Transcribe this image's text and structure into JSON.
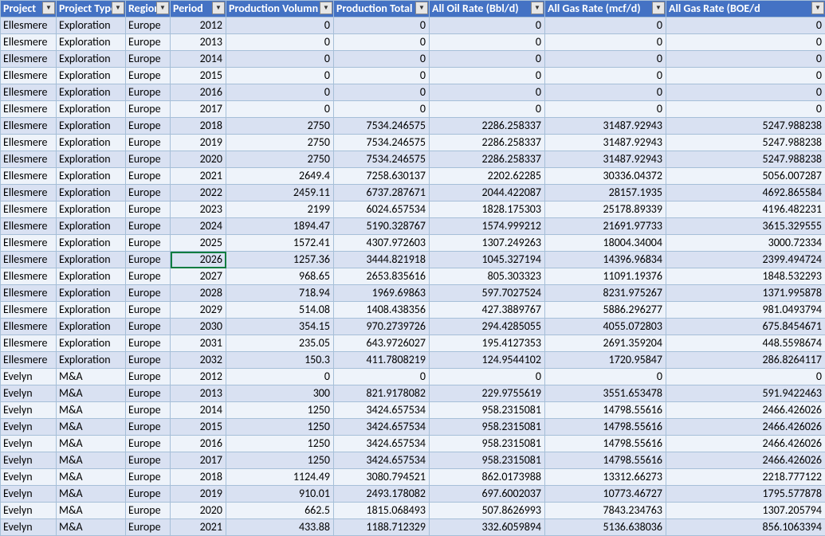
{
  "columns": [
    {
      "label": "Project",
      "align": "txt"
    },
    {
      "label": "Project Type",
      "align": "txt"
    },
    {
      "label": "Region",
      "align": "txt"
    },
    {
      "label": "Period",
      "align": "num"
    },
    {
      "label": "Production Volumn",
      "align": "num"
    },
    {
      "label": "Production Total",
      "align": "num"
    },
    {
      "label": "All Oil Rate (Bbl/d)",
      "align": "num"
    },
    {
      "label": "All Gas Rate (mcf/d)",
      "align": "num"
    },
    {
      "label": "All Gas Rate (BOE/d",
      "align": "num"
    }
  ],
  "rows": [
    [
      "Ellesmere",
      "Exploration",
      "Europe",
      "2012",
      "0",
      "0",
      "0",
      "0",
      "0"
    ],
    [
      "Ellesmere",
      "Exploration",
      "Europe",
      "2013",
      "0",
      "0",
      "0",
      "0",
      "0"
    ],
    [
      "Ellesmere",
      "Exploration",
      "Europe",
      "2014",
      "0",
      "0",
      "0",
      "0",
      "0"
    ],
    [
      "Ellesmere",
      "Exploration",
      "Europe",
      "2015",
      "0",
      "0",
      "0",
      "0",
      "0"
    ],
    [
      "Ellesmere",
      "Exploration",
      "Europe",
      "2016",
      "0",
      "0",
      "0",
      "0",
      "0"
    ],
    [
      "Ellesmere",
      "Exploration",
      "Europe",
      "2017",
      "0",
      "0",
      "0",
      "0",
      "0"
    ],
    [
      "Ellesmere",
      "Exploration",
      "Europe",
      "2018",
      "2750",
      "7534.246575",
      "2286.258337",
      "31487.92943",
      "5247.988238"
    ],
    [
      "Ellesmere",
      "Exploration",
      "Europe",
      "2019",
      "2750",
      "7534.246575",
      "2286.258337",
      "31487.92943",
      "5247.988238"
    ],
    [
      "Ellesmere",
      "Exploration",
      "Europe",
      "2020",
      "2750",
      "7534.246575",
      "2286.258337",
      "31487.92943",
      "5247.988238"
    ],
    [
      "Ellesmere",
      "Exploration",
      "Europe",
      "2021",
      "2649.4",
      "7258.630137",
      "2202.62285",
      "30336.04372",
      "5056.007287"
    ],
    [
      "Ellesmere",
      "Exploration",
      "Europe",
      "2022",
      "2459.11",
      "6737.287671",
      "2044.422087",
      "28157.1935",
      "4692.865584"
    ],
    [
      "Ellesmere",
      "Exploration",
      "Europe",
      "2023",
      "2199",
      "6024.657534",
      "1828.175303",
      "25178.89339",
      "4196.482231"
    ],
    [
      "Ellesmere",
      "Exploration",
      "Europe",
      "2024",
      "1894.47",
      "5190.328767",
      "1574.999212",
      "21691.97733",
      "3615.329555"
    ],
    [
      "Ellesmere",
      "Exploration",
      "Europe",
      "2025",
      "1572.41",
      "4307.972603",
      "1307.249263",
      "18004.34004",
      "3000.72334"
    ],
    [
      "Ellesmere",
      "Exploration",
      "Europe",
      "2026",
      "1257.36",
      "3444.821918",
      "1045.327194",
      "14396.96834",
      "2399.494724"
    ],
    [
      "Ellesmere",
      "Exploration",
      "Europe",
      "2027",
      "968.65",
      "2653.835616",
      "805.303323",
      "11091.19376",
      "1848.532293"
    ],
    [
      "Ellesmere",
      "Exploration",
      "Europe",
      "2028",
      "718.94",
      "1969.69863",
      "597.7027524",
      "8231.975267",
      "1371.995878"
    ],
    [
      "Ellesmere",
      "Exploration",
      "Europe",
      "2029",
      "514.08",
      "1408.438356",
      "427.3889767",
      "5886.296277",
      "981.0493794"
    ],
    [
      "Ellesmere",
      "Exploration",
      "Europe",
      "2030",
      "354.15",
      "970.2739726",
      "294.4285055",
      "4055.072803",
      "675.8454671"
    ],
    [
      "Ellesmere",
      "Exploration",
      "Europe",
      "2031",
      "235.05",
      "643.9726027",
      "195.4127353",
      "2691.359204",
      "448.5598674"
    ],
    [
      "Ellesmere",
      "Exploration",
      "Europe",
      "2032",
      "150.3",
      "411.7808219",
      "124.9544102",
      "1720.95847",
      "286.8264117"
    ],
    [
      "Evelyn",
      "M&A",
      "Europe",
      "2012",
      "0",
      "0",
      "0",
      "0",
      "0"
    ],
    [
      "Evelyn",
      "M&A",
      "Europe",
      "2013",
      "300",
      "821.9178082",
      "229.9755619",
      "3551.653478",
      "591.9422463"
    ],
    [
      "Evelyn",
      "M&A",
      "Europe",
      "2014",
      "1250",
      "3424.657534",
      "958.2315081",
      "14798.55616",
      "2466.426026"
    ],
    [
      "Evelyn",
      "M&A",
      "Europe",
      "2015",
      "1250",
      "3424.657534",
      "958.2315081",
      "14798.55616",
      "2466.426026"
    ],
    [
      "Evelyn",
      "M&A",
      "Europe",
      "2016",
      "1250",
      "3424.657534",
      "958.2315081",
      "14798.55616",
      "2466.426026"
    ],
    [
      "Evelyn",
      "M&A",
      "Europe",
      "2017",
      "1250",
      "3424.657534",
      "958.2315081",
      "14798.55616",
      "2466.426026"
    ],
    [
      "Evelyn",
      "M&A",
      "Europe",
      "2018",
      "1124.49",
      "3080.794521",
      "862.0173988",
      "13312.66273",
      "2218.777122"
    ],
    [
      "Evelyn",
      "M&A",
      "Europe",
      "2019",
      "910.01",
      "2493.178082",
      "697.6002037",
      "10773.46727",
      "1795.577878"
    ],
    [
      "Evelyn",
      "M&A",
      "Europe",
      "2020",
      "662.5",
      "1815.068493",
      "507.8626993",
      "7843.234763",
      "1307.205794"
    ],
    [
      "Evelyn",
      "M&A",
      "Europe",
      "2021",
      "433.88",
      "1188.712329",
      "332.6059894",
      "5136.638036",
      "856.1063394"
    ]
  ],
  "selected_cell": {
    "row": 14,
    "col": 3
  }
}
